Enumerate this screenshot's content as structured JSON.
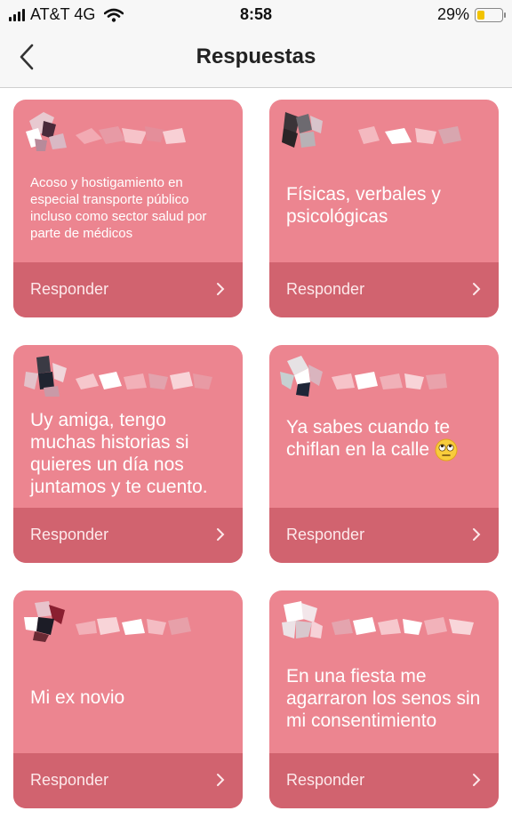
{
  "status_bar": {
    "carrier": "AT&T 4G",
    "time": "8:58",
    "battery": "29%",
    "battery_level": 0.29
  },
  "nav": {
    "title": "Respuestas"
  },
  "cards": [
    {
      "text": "Acoso y hostigamiento en especial transporte público incluso como sector salud por parte de médicos",
      "reply": "Responder"
    },
    {
      "text": "Físicas, verbales y psicológicas",
      "reply": "Responder"
    },
    {
      "text": "Uy amiga, tengo muchas historias si quieres un día nos juntamos y te cuento.",
      "reply": "Responder"
    },
    {
      "text": "Ya sabes cuando te chiflan en la calle",
      "emoji": "face-with-rolling-eyes",
      "reply": "Responder"
    },
    {
      "text": "Mi ex novio",
      "reply": "Responder"
    },
    {
      "text": "En una fiesta me agarraron los senos sin mi consentimiento",
      "reply": "Responder"
    }
  ],
  "colors": {
    "card_bg": "#ec8590",
    "card_footer": "#d1636f"
  }
}
